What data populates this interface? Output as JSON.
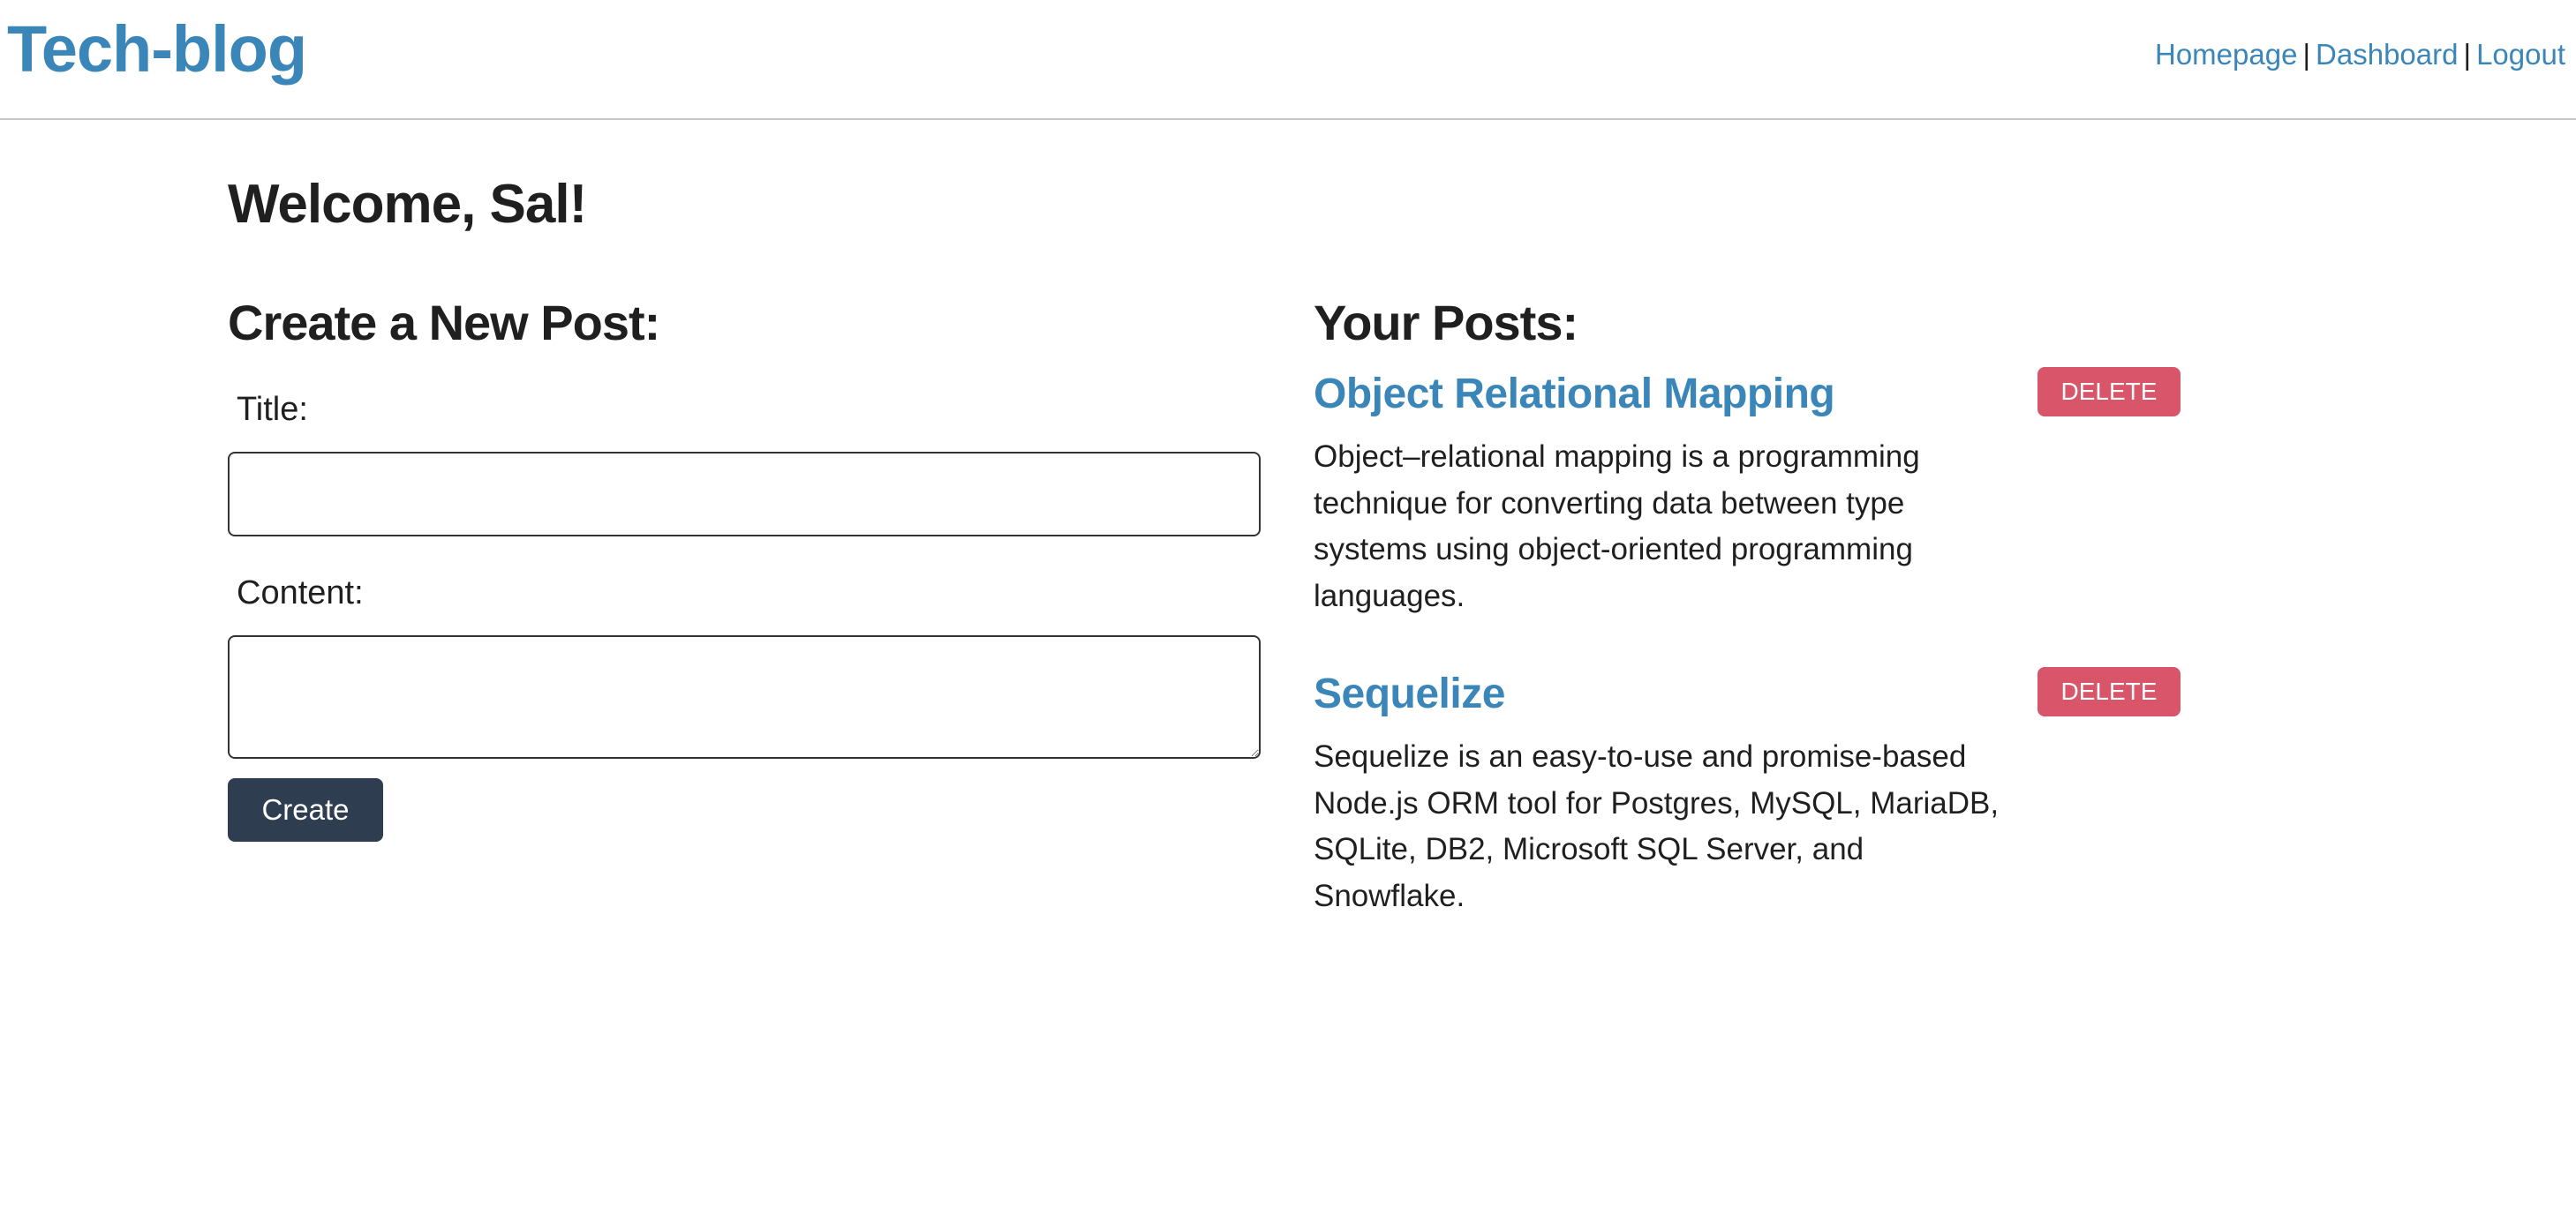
{
  "header": {
    "logo": "Tech-blog",
    "nav": {
      "homepage": "Homepage",
      "dashboard": "Dashboard",
      "logout": "Logout",
      "separator": "|"
    }
  },
  "welcome": "Welcome, Sal!",
  "create_form": {
    "heading": "Create a New Post:",
    "title_label": "Title:",
    "title_value": "",
    "content_label": "Content:",
    "content_value": "",
    "submit_label": "Create"
  },
  "posts_section": {
    "heading": "Your Posts:",
    "posts": [
      {
        "title": "Object Relational Mapping",
        "body": "Object–relational mapping is a programming technique for converting data between type systems using object-oriented programming languages.",
        "delete_label": "DELETE"
      },
      {
        "title": "Sequelize",
        "body": "Sequelize is an easy-to-use and promise-based Node.js ORM tool for Postgres, MySQL, MariaDB, SQLite, DB2, Microsoft SQL Server, and Snowflake.",
        "delete_label": "DELETE"
      }
    ]
  },
  "colors": {
    "link": "#3b86b8",
    "create_button": "#2e3e50",
    "delete_button": "#d9556a"
  }
}
